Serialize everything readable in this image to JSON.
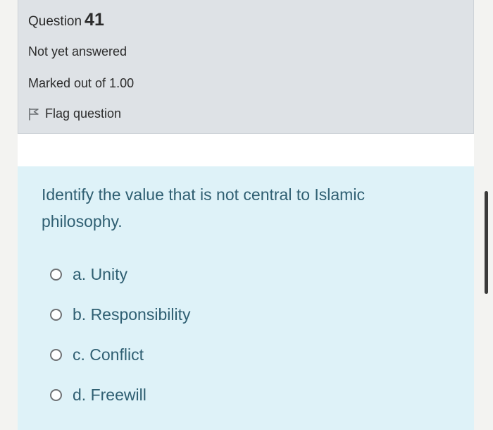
{
  "question_info": {
    "prefix": "Question",
    "number": "41",
    "state": "Not yet answered",
    "grade": "Marked out of 1.00",
    "flag_label": "Flag question"
  },
  "question": {
    "text": "Identify the value that is not central to Islamic philosophy.",
    "options": [
      {
        "label": "a. Unity",
        "selected": false
      },
      {
        "label": "b. Responsibility",
        "selected": false
      },
      {
        "label": "c. Conflict",
        "selected": false
      },
      {
        "label": "d. Freewill",
        "selected": false
      }
    ]
  },
  "colors": {
    "info_background": "#dee2e6",
    "formulation_background": "#def2f8",
    "question_text": "#2f5f72",
    "page_background": "#f3f3f1"
  },
  "icons": {
    "flag": "flag-outline-icon",
    "radio": "radio-unchecked"
  }
}
